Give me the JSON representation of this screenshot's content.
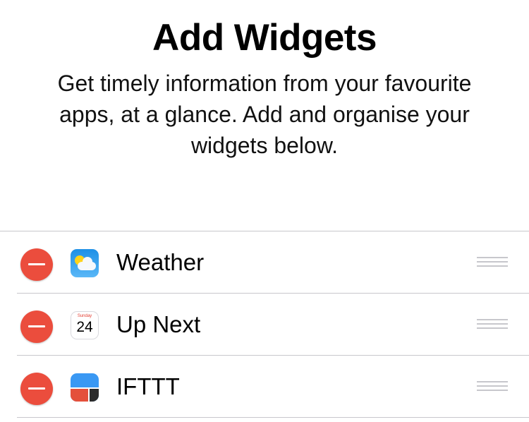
{
  "header": {
    "title": "Add Widgets",
    "subtitle": "Get timely information from your favourite apps, at a glance. Add and organise your widgets below."
  },
  "widgets": [
    {
      "label": "Weather",
      "icon": "weather-app-icon"
    },
    {
      "label": "Up Next",
      "icon": "calendar-app-icon",
      "calendar_day": "Sunday",
      "calendar_date": "24"
    },
    {
      "label": "IFTTT",
      "icon": "ifttt-app-icon"
    }
  ],
  "colors": {
    "remove_button": "#eb4d3d",
    "separator": "#c8c7cc",
    "reorder_handle": "#c7c7cc"
  }
}
